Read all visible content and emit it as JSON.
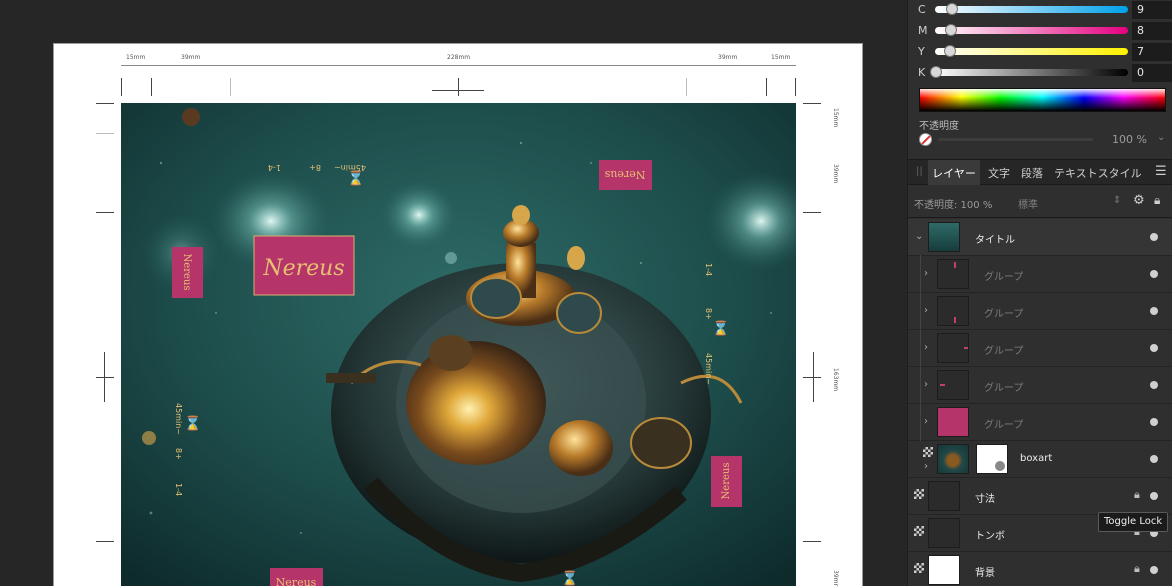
{
  "canvas": {
    "dimensions": {
      "left_bleed": "15mm",
      "left_flap": "39mm",
      "width": "228mm",
      "right_flap": "39mm",
      "right_bleed": "15mm",
      "v_top": "15mm",
      "v_flap": "39mm",
      "v_height": "163mm",
      "v_bottom": "39mm"
    },
    "artwork": {
      "logo_text": "Nereus",
      "spine_text_1": "45min~",
      "spine_text_2": "8+",
      "spine_text_3": "1-4"
    }
  },
  "color": {
    "sliders": [
      {
        "label": "C",
        "value": "9",
        "fraction": 0.09,
        "gradient": [
          "#ffffff",
          "#00a0e9"
        ]
      },
      {
        "label": "M",
        "value": "8",
        "fraction": 0.08,
        "gradient": [
          "#ffffff",
          "#e4007f"
        ]
      },
      {
        "label": "Y",
        "value": "7",
        "fraction": 0.07,
        "gradient": [
          "#ffffff",
          "#fff100"
        ]
      },
      {
        "label": "K",
        "value": "0",
        "fraction": 0.0,
        "gradient": [
          "#ffffff",
          "#000000"
        ]
      }
    ],
    "opacity_label": "不透明度",
    "opacity_value": "100 %"
  },
  "tabs": [
    {
      "label": "レイヤー",
      "active": true
    },
    {
      "label": "文字",
      "active": false
    },
    {
      "label": "段落",
      "active": false
    },
    {
      "label": "テキストスタイル",
      "active": false
    }
  ],
  "layer_options": {
    "opacity": "不透明度: 100 %",
    "blend_mode": "標準"
  },
  "layers": [
    {
      "name": "タイトル",
      "dim": false
    },
    {
      "name": "グループ",
      "dim": true
    },
    {
      "name": "グループ",
      "dim": true
    },
    {
      "name": "グループ",
      "dim": true
    },
    {
      "name": "グループ",
      "dim": true
    },
    {
      "name": "グループ",
      "dim": true
    },
    {
      "name": "boxart",
      "dim": false
    },
    {
      "name": "寸法",
      "dim": false
    },
    {
      "name": "トンボ",
      "dim": false
    },
    {
      "name": "背景",
      "dim": false
    }
  ],
  "tooltip": "Toggle Lock",
  "icons": {
    "expand": "chevron-right-icon",
    "collapse": "chevron-down-icon",
    "settings": "gear-icon",
    "lock": "lock-icon",
    "menu": "hamburger-menu-icon",
    "visibility": "visibility-dot-icon"
  },
  "colors": {
    "panel_bg": "#2f2f2f",
    "canvas_bg": "#262626",
    "sea_teal": "#1f5250",
    "label_pink": "#b5356a",
    "label_gold": "#e6c072"
  }
}
